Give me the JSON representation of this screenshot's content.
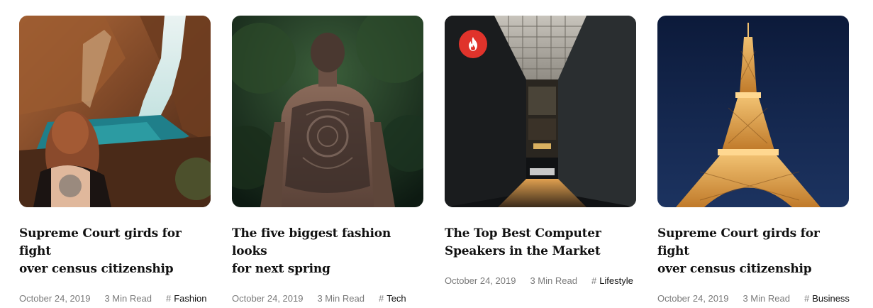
{
  "posts": [
    {
      "title": "Supreme Court girds for fight\nover census citizenship",
      "date": "October 24, 2019",
      "read_time": "3 Min Read",
      "tag_hash": "#",
      "tag": "Fashion"
    },
    {
      "title": "The five biggest fashion looks\nfor next spring",
      "date": "October 24, 2019",
      "read_time": "3 Min Read",
      "tag_hash": "#",
      "tag": "Tech"
    },
    {
      "title": "The Top Best Computer\nSpeakers in the Market",
      "date": "October 24, 2019",
      "read_time": "3 Min Read",
      "tag_hash": "#",
      "tag": "Lifestyle",
      "badge_icon": "flame-icon",
      "badge_color": "#e0332b"
    },
    {
      "title": "Supreme Court girds for fight\nover census citizenship",
      "date": "October 24, 2019",
      "read_time": "3 Min Read",
      "tag_hash": "#",
      "tag": "Business"
    }
  ]
}
